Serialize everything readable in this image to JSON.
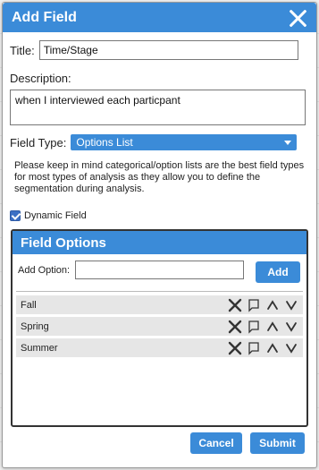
{
  "dialog": {
    "title": "Add Field",
    "close_icon": "close-icon"
  },
  "form": {
    "title_label": "Title:",
    "title_value": "Time/Stage",
    "description_label": "Description:",
    "description_value": "when I interviewed each particpant",
    "field_type_label": "Field Type:",
    "field_type_value": "Options List",
    "note": "Please keep in mind categorical/option lists are the best field types for most types of analysis as they allow you to define the segmentation during analysis.",
    "dynamic_field_label": "Dynamic Field",
    "dynamic_field_checked": true
  },
  "field_options": {
    "title": "Field Options",
    "add_option_label": "Add Option:",
    "add_option_value": "",
    "add_button": "Add",
    "options": [
      {
        "label": "Fall"
      },
      {
        "label": "Spring"
      },
      {
        "label": "Summer"
      }
    ],
    "row_tools": [
      "delete-icon",
      "rename-icon",
      "move-up-icon",
      "move-down-icon"
    ]
  },
  "footer": {
    "cancel_label": "Cancel",
    "submit_label": "Submit"
  },
  "colors": {
    "accent": "#3b8bd8",
    "row_bg": "#e6e6e6"
  }
}
